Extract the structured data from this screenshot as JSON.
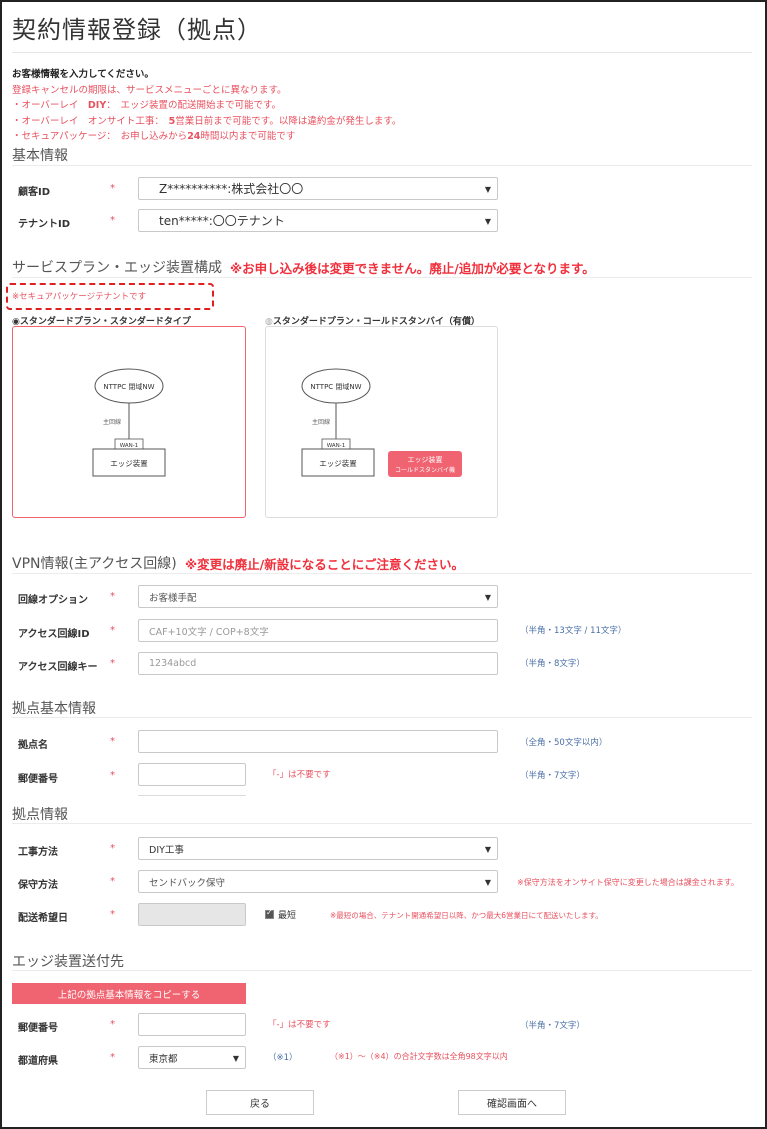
{
  "page": {
    "title": "契約情報登録（拠点）"
  },
  "notice": {
    "line1": "お客様情報を入力してください。",
    "line2": "登録キャンセルの期限は、サービスメニューごとに異なります。",
    "line3a": "・オーバーレイ　",
    "line3b": "DIY",
    "line3c": "：　エッジ装置の配送開始まで可能です。",
    "line4a": "・オーバーレイ　オンサイト工事：　",
    "line4b": "5",
    "line4c": "営業日前まで可能です。以降は違約金が発生します。",
    "line5a": "・セキュアパッケージ：　お申し込みから",
    "line5b": "24",
    "line5c": "時間以内まで可能です"
  },
  "basic": {
    "section_title": "基本情報",
    "customer_id_label": "顧客ID",
    "customer_id_value": "Z**********:株式会社〇〇",
    "tenant_id_label": "テナントID",
    "tenant_id_value": "ten*****:〇〇テナント",
    "required_mark": "*"
  },
  "plan": {
    "section_title": "サービスプラン・エッジ装置構成",
    "warning": "※お申し込み後は変更できません。廃止/追加が必要となります。",
    "secure_note": "※セキュアパッケージテナントです",
    "options": [
      {
        "label": "スタンダードプラン・スタンダードタイプ",
        "selected": true,
        "cloud_label": "NTTPC 閉域NW",
        "line_label": "主回線",
        "wan_label": "WAN-1",
        "edge_label": "エッジ装置"
      },
      {
        "label": "スタンダードプラン・コールドスタンバイ（有償）",
        "selected": false,
        "cloud_label": "NTTPC 閉域NW",
        "line_label": "主回線",
        "wan_label": "WAN-1",
        "edge_label": "エッジ装置",
        "standby_label_1": "エッジ装置",
        "standby_label_2": "コールドスタンバイ機"
      }
    ]
  },
  "vpn": {
    "section_title": "VPN情報(主アクセス回線)",
    "warning": "※変更は廃止/新設になることにご注意ください。",
    "line_option_label": "回線オプション",
    "line_option_value": "お客様手配",
    "access_id_label": "アクセス回線ID",
    "access_id_placeholder": "CAF+10文字 / COP+8文字",
    "access_id_hint": "（半角・13文字 / 11文字）",
    "access_key_label": "アクセス回線キー",
    "access_key_placeholder": "1234abcd",
    "access_key_hint": "（半角・8文字）"
  },
  "site_basic": {
    "section_title": "拠点基本情報",
    "name_label": "拠点名",
    "name_hint": "（全角・50文字以内）",
    "postal_label": "郵便番号",
    "postal_note": "「-」は不要です",
    "postal_hint": "（半角・7文字）"
  },
  "site_info": {
    "section_title": "拠点情報",
    "work_method_label": "工事方法",
    "work_method_value": "DIY工事",
    "maintenance_label": "保守方法",
    "maintenance_value": "センドバック保守",
    "maintenance_note": "※保守方法をオンサイト保守に変更した場合は課金されます。",
    "delivery_label": "配送希望日",
    "earliest_label": "最短",
    "delivery_note": "※最短の場合、テナント開通希望日以降、かつ最大6営業日にて配送いたします。"
  },
  "shipping": {
    "section_title": "エッジ装置送付先",
    "copy_button": "上記の拠点基本情報をコピーする",
    "postal_label": "郵便番号",
    "postal_note": "「-」は不要です",
    "postal_hint": "（半角・7文字）",
    "prefecture_label": "都道府県",
    "prefecture_value": "東京都",
    "note_ref": "（※1）",
    "note_total": "（※1）～（※4）の合計文字数は全角98文字以内"
  },
  "footer": {
    "back_button": "戻る",
    "confirm_button": "確認画面へ"
  },
  "colors": {
    "accent": "#f06472",
    "warning": "#f0303c",
    "hint": "#4a6fa5"
  }
}
